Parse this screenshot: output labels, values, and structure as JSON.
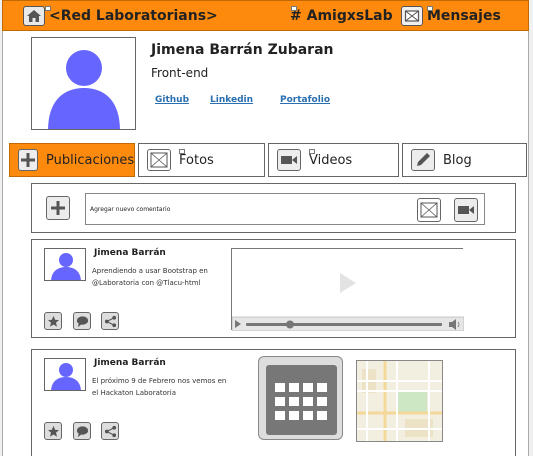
{
  "topbar": {
    "home_label": "<Red Laboratorians>",
    "hashtag_label": "# AmigxsLab",
    "messages_label": "Mensajes"
  },
  "profile": {
    "name": "Jimena Barrán Zubaran",
    "role": "Front-end",
    "links": [
      "Github",
      "Linkedin",
      "Portafolio"
    ]
  },
  "tabs": [
    {
      "label": "Publicaciones",
      "icon": "plus-icon",
      "active": true
    },
    {
      "label": "Fotos",
      "icon": "image-icon",
      "active": false
    },
    {
      "label": "Videos",
      "icon": "video-icon",
      "active": false
    },
    {
      "label": "Blog",
      "icon": "pencil-icon",
      "active": false
    }
  ],
  "composer": {
    "placeholder": "Agregar nuevo comentario"
  },
  "posts": [
    {
      "author": "Jimena Barrán",
      "text": "Aprendiendo a usar Bootstrap en @Laboratoria con @Tlacu-html",
      "media": "video-player"
    },
    {
      "author": "Jimena Barrán",
      "text": "El próximo 9 de Febrero nos vemos en el Hackaton Laboratoria",
      "media": "calendar-and-map"
    }
  ],
  "colors": {
    "accent": "#fd8a0d",
    "avatar": "#6666ff",
    "link": "#2a6fb0"
  }
}
